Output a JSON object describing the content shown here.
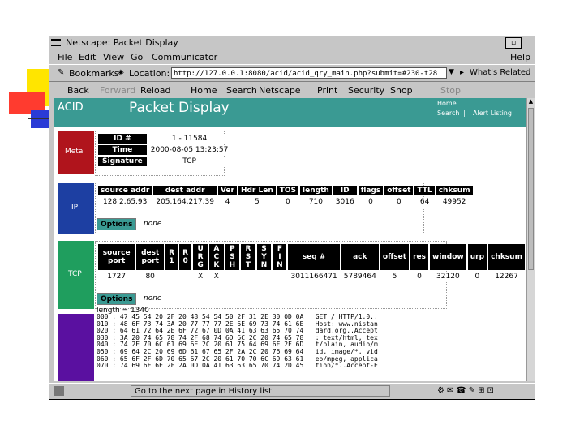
{
  "window": {
    "title": "Netscape: Packet Display",
    "help_label": "Help"
  },
  "menu": [
    "File",
    "Edit",
    "View",
    "Go",
    "Communicator"
  ],
  "location": {
    "bookmarks_label": "Bookmarks",
    "location_label": "Location:",
    "url": "http://127.0.0.1:8080/acid/acid_qry_main.php?submit=#230-t28",
    "related_label": "What's Related"
  },
  "toolbar": [
    "Back",
    "Forward",
    "Reload",
    "Home",
    "Search",
    "Netscape",
    "Print",
    "Security",
    "Shop",
    "Stop"
  ],
  "page": {
    "app_name": "ACID",
    "title": "Packet Display",
    "home_link": "Home",
    "search_link": "Search",
    "separator": "|",
    "alert_listing_link": "Alert Listing"
  },
  "meta": {
    "band_label": "Meta",
    "rows": [
      {
        "label": "ID #",
        "value": "1 - 11584"
      },
      {
        "label": "Time",
        "value": "2000-08-05 13:23:57"
      },
      {
        "label": "Signature",
        "value": "TCP"
      }
    ]
  },
  "ip": {
    "band_label": "IP",
    "headers": [
      "source addr",
      "dest addr",
      "Ver",
      "Hdr Len",
      "TOS",
      "length",
      "ID",
      "flags",
      "offset",
      "TTL",
      "chksum"
    ],
    "values": [
      "128.2.65.93",
      "205.164.217.39",
      "4",
      "5",
      "0",
      "710",
      "3016",
      "0",
      "0",
      "64",
      "49952"
    ],
    "options_label": "Options",
    "options_value": "none"
  },
  "tcp": {
    "band_label": "TCP",
    "headers": [
      "source port",
      "dest port",
      "R 1",
      "R 0",
      "U R G",
      "A C K",
      "P S H",
      "R S T",
      "S Y N",
      "F I N",
      "seq #",
      "ack",
      "offset",
      "res",
      "window",
      "urp",
      "chksum"
    ],
    "values": [
      "1727",
      "80",
      "",
      "",
      "X",
      "X",
      "",
      "",
      "",
      "",
      "3011166471",
      "5789464",
      "5",
      "0",
      "32120",
      "0",
      "12267"
    ],
    "options_label": "Options",
    "options_value": "none"
  },
  "payload": {
    "length_text": "length = 1340",
    "lines": [
      "000 : 47 45 54 20 2F 20 48 54 54 50 2F 31 2E 30 0D 0A   GET / HTTP/1.0..",
      "010 : 48 6F 73 74 3A 20 77 77 77 2E 6E 69 73 74 61 6E   Host: www.nistan",
      "020 : 64 61 72 64 2E 6F 72 67 0D 0A 41 63 63 65 70 74   dard.org..Accept",
      "030 : 3A 20 74 65 78 74 2F 68 74 6D 6C 2C 20 74 65 78   : text/html, tex",
      "040 : 74 2F 70 6C 61 69 6E 2C 20 61 75 64 69 6F 2F 6D   t/plain, audio/m",
      "050 : 69 64 2C 20 69 6D 61 67 65 2F 2A 2C 20 76 69 64   id, image/*, vid",
      "060 : 65 6F 2F 6D 70 65 67 2C 20 61 70 70 6C 69 63 61   eo/mpeg, applica",
      "070 : 74 69 6F 6E 2F 2A 0D 0A 41 63 63 65 70 74 2D 45   tion/*..Accept-E"
    ]
  },
  "status": {
    "text": "Go to the next page in History list"
  },
  "colors": {
    "teal": "#3a9a93",
    "meta": "#b0141c",
    "ip": "#1d3fa2",
    "tcp": "#1f9e5e",
    "payload": "#5a10a0"
  }
}
